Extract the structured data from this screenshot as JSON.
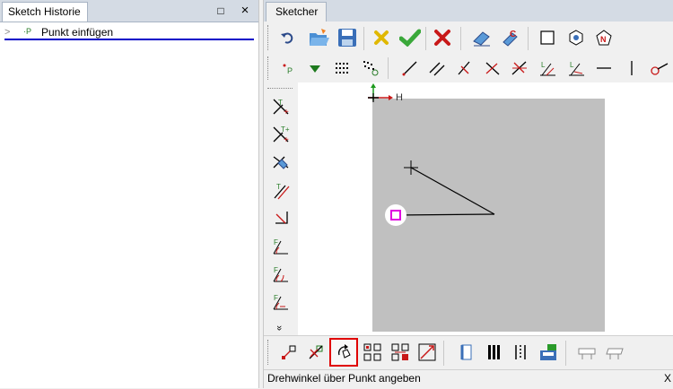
{
  "left_panel": {
    "tab_title": "Sketch Historie",
    "restore_glyph": "□",
    "close_glyph": "×",
    "history_items": [
      {
        "chevron": ">",
        "icon": "point-insert-icon",
        "icon_text": "·P",
        "label": "Punkt einfügen"
      }
    ]
  },
  "right_panel": {
    "tab_title": "Sketcher",
    "toolbar1_icons": [
      "undo-icon",
      "open-folder-icon",
      "save-icon",
      "cancel-yellow-x-icon",
      "confirm-check-icon",
      "delete-red-x-icon",
      "eraser-icon",
      "format-icon",
      "square-icon",
      "hexagon-cube-icon",
      "polygon-n-icon"
    ],
    "toolbar2_icons": [
      "point-icon",
      "triangle-down-icon",
      "grid-points-icon",
      "point-pattern-icon",
      "line-icon",
      "parallel-line-icon",
      "angle-line-icon",
      "cross-line-icon",
      "multi-line-icon",
      "angle-l-icon",
      "angle-l2-icon",
      "horizontal-line-icon",
      "vertical-line-icon",
      "circle-line-icon"
    ],
    "vertical_icons": [
      "trim-icon",
      "trim-plus-icon",
      "trim-cross-icon",
      "offset-icon",
      "corner-icon",
      "fillet-icon",
      "fillet-icon-2",
      "fillet-icon-3"
    ],
    "more_glyph": "»",
    "axis_h_label": "H",
    "bottom_icons": [
      "move-icon",
      "move-cross-icon",
      "rotate-icon",
      "copy-pattern-icon",
      "mirror-pattern-icon",
      "scale-icon",
      "book-icon",
      "column-bars-icon",
      "dotted-bars-icon",
      "save-green-icon",
      "table-icon",
      "table-icon-2"
    ],
    "status_text": "Drehwinkel über Punkt angeben",
    "status_close": "X",
    "accent_color": "#0000c8",
    "highlight_color": "#e00000",
    "marker_color": "#e000e0"
  }
}
